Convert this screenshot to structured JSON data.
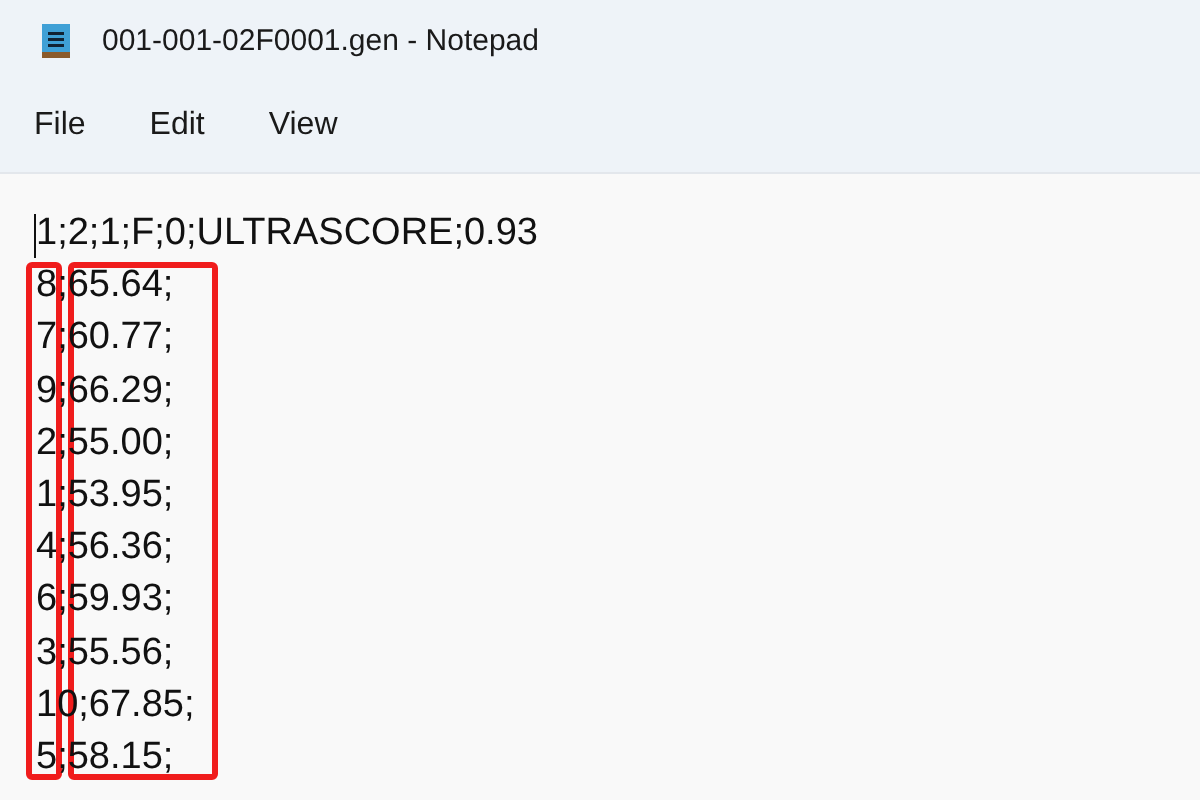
{
  "window": {
    "title": "001-001-02F0001.gen - Notepad"
  },
  "menu": [
    "File",
    "Edit",
    "View"
  ],
  "editor": {
    "lines": [
      "1;2;1;F;0;ULTRASCORE;0.93",
      "8;65.64;",
      "7;60.77;",
      "9;66.29;",
      "2;55.00;",
      "1;53.95;",
      "4;56.36;",
      "6;59.93;",
      "3;55.56;",
      "10;67.85;",
      "5;58.15;"
    ],
    "caret": true
  },
  "highlight_boxes": [
    {
      "kind": "outline"
    },
    {
      "kind": "outline"
    }
  ]
}
